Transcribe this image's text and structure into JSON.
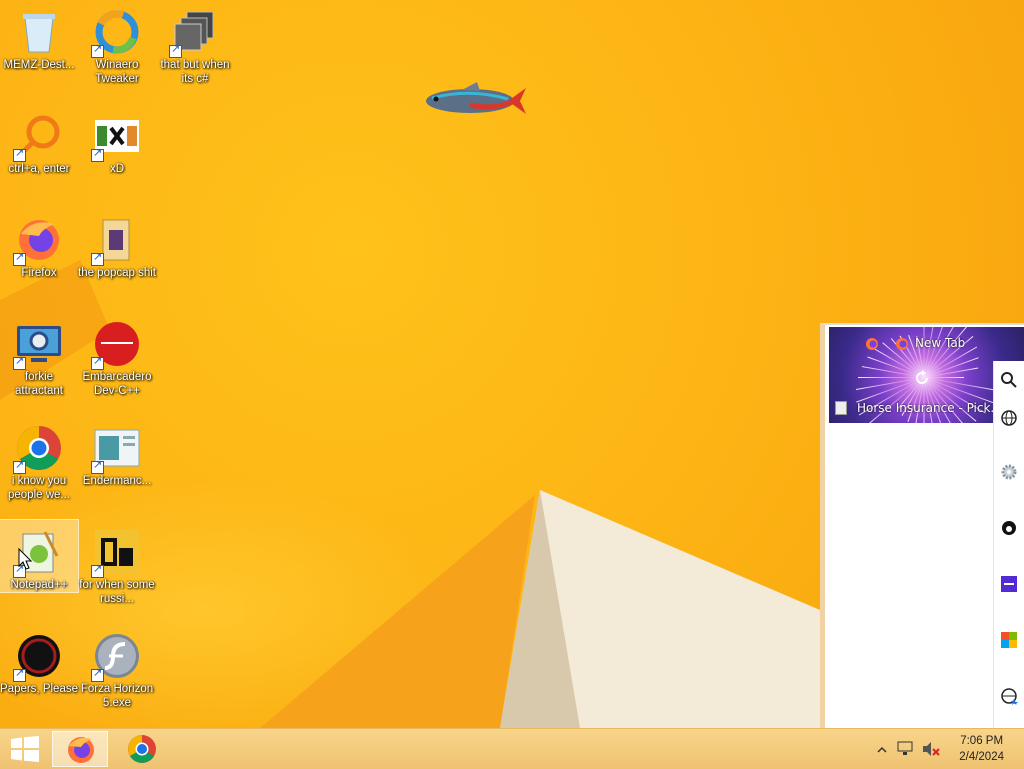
{
  "desktop": {
    "icons": [
      {
        "label": "MEMZ-Dest...",
        "icon": "recycle-bin-icon"
      },
      {
        "label": "Winaero Tweaker",
        "icon": "winaero-tweaker-icon"
      },
      {
        "label": "that but when its c#",
        "icon": "stacked-windows-icon"
      },
      {
        "label": "ctrl+a, enter",
        "icon": "magnifier-ring-icon"
      },
      {
        "label": "xD",
        "icon": "hxd-hex-editor-icon"
      },
      {
        "label": "Firefox",
        "icon": "firefox-icon"
      },
      {
        "label": "the popcap shit",
        "icon": "folder-icon"
      },
      {
        "label": "forkie attractant",
        "icon": "monitor-gear-icon"
      },
      {
        "label": "Embarcadero Dev-C++",
        "icon": "dev-cpp-icon"
      },
      {
        "label": "i know you people we...",
        "icon": "chrome-icon"
      },
      {
        "label": "Endermanc...",
        "icon": "window-app-icon"
      },
      {
        "label": "Notepad++",
        "icon": "notepad-plus-plus-icon"
      },
      {
        "label": "for when some russi...",
        "icon": "de-app-icon"
      },
      {
        "label": "Papers, Please",
        "icon": "papers-please-icon"
      },
      {
        "label": "Forza Horizon 5.exe",
        "icon": "flash-player-icon"
      }
    ]
  },
  "firefox_panel": {
    "tab_new": "New Tab",
    "tab_page": "Horse Insurance - Pick..."
  },
  "taskbar": {
    "apps": [
      "firefox-icon",
      "chrome-icon"
    ],
    "clock_time": "7:06 PM",
    "clock_date": "2/4/2024",
    "tray_icons": [
      "show-hidden-icons-chevron-icon",
      "network-icon",
      "speaker-muted-icon"
    ]
  },
  "colors": {
    "wallpaper": "#fdb515",
    "taskbar": "#f4cd82",
    "firefox_header": "#6b3fc0",
    "dev_cpp_red": "#d81e1e",
    "chrome_blue": "#1a73e8"
  }
}
